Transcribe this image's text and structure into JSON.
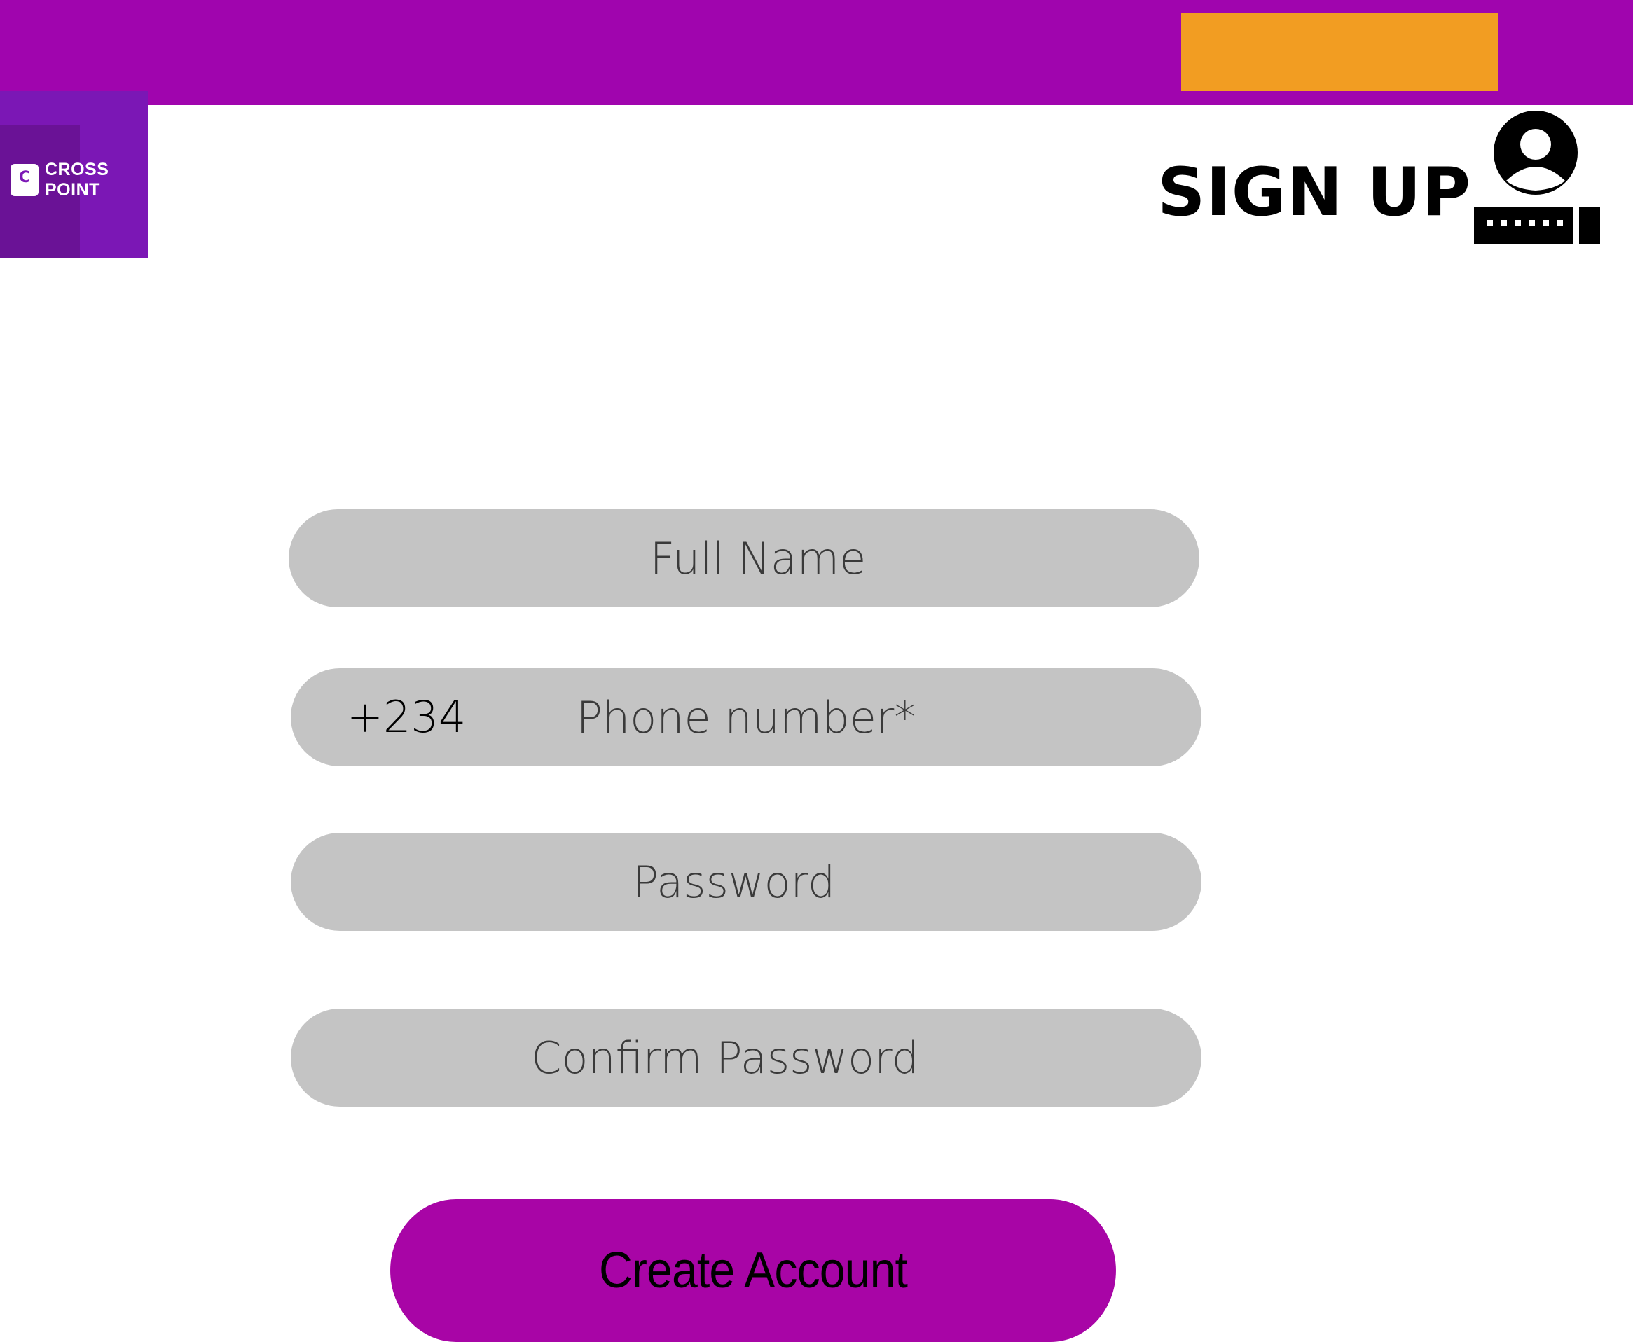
{
  "header": {
    "brand_color": "#a005ae",
    "action_button_color": "#f29d22",
    "action_label": ""
  },
  "logo": {
    "mark": "C",
    "line1": "CROSS",
    "line2": "POINT",
    "color": "#7b17b5"
  },
  "page": {
    "title": "SIGN UP",
    "title_icon": "user-login-icon"
  },
  "form": {
    "full_name_placeholder": "Full Name",
    "phone_prefix": "+234",
    "phone_placeholder": "Phone number*",
    "password_placeholder": "Password",
    "confirm_password_placeholder": "Confirm Password",
    "field_color": "#c4c4c4",
    "submit_label": "Create Account",
    "submit_color": "#a805a6"
  }
}
